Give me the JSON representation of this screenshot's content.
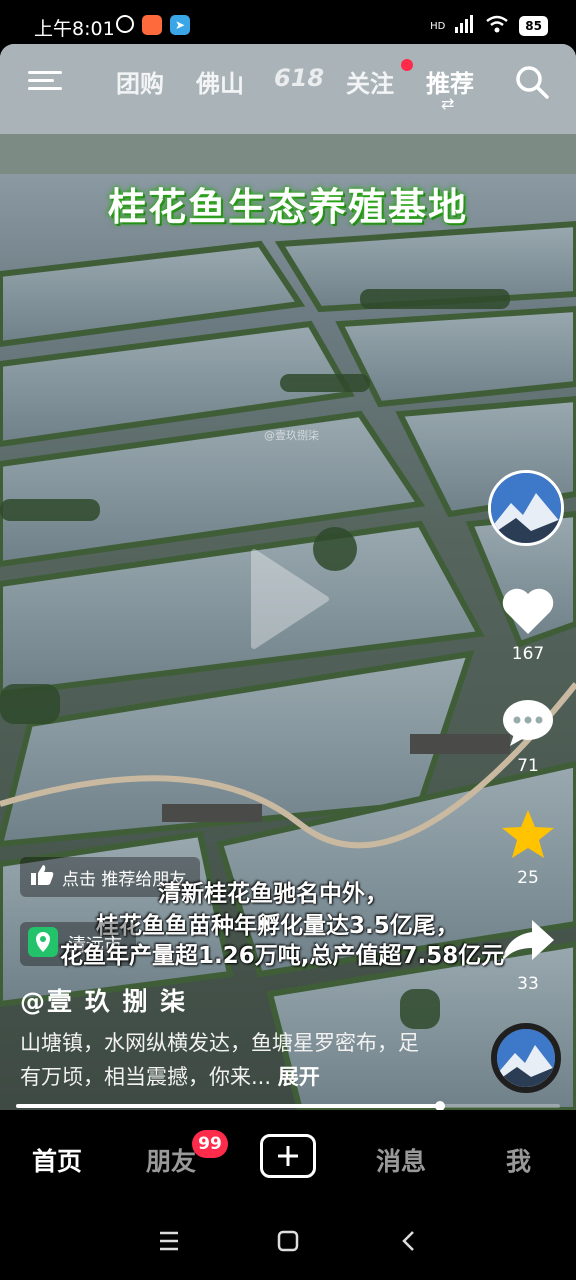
{
  "status_bar": {
    "time": "上午8:01",
    "battery": "85",
    "network": "HD"
  },
  "top_nav": {
    "items": [
      {
        "label": "团购"
      },
      {
        "label": "佛山"
      },
      {
        "label": "618"
      },
      {
        "label": "关注"
      },
      {
        "label": "推荐"
      }
    ],
    "active": "推荐"
  },
  "video": {
    "title_banner": "桂花鱼生态养殖基地",
    "watermark": "@壹玖捌柒",
    "subtitle_line1": "清新桂花鱼驰名中外，",
    "subtitle_line2": "桂花鱼鱼苗种年孵化量达3.5亿尾，",
    "subtitle_line3": "花鱼年产量超1.26万吨,总产值超7.58亿元",
    "progress": 0.78
  },
  "actions": {
    "like_count": "167",
    "comment_count": "71",
    "favorite_count": "25",
    "share_count": "33"
  },
  "share_prompt": {
    "label": "点击 推荐给朋友"
  },
  "location": {
    "label": "清远市"
  },
  "post": {
    "author": "@壹 玖 捌 柒",
    "description": "山塘镇，水网纵横发达，鱼塘星罗密布，足有万顷，相当震撼，你来...",
    "expand_label": "展开"
  },
  "tab_bar": {
    "home": "首页",
    "friends": "朋友",
    "friends_badge": "99",
    "messages": "消息",
    "me": "我"
  },
  "colors": {
    "accent_red": "#ff2b4a",
    "favorite_yellow": "#ffc300",
    "banner_green": "#2ea81e"
  }
}
